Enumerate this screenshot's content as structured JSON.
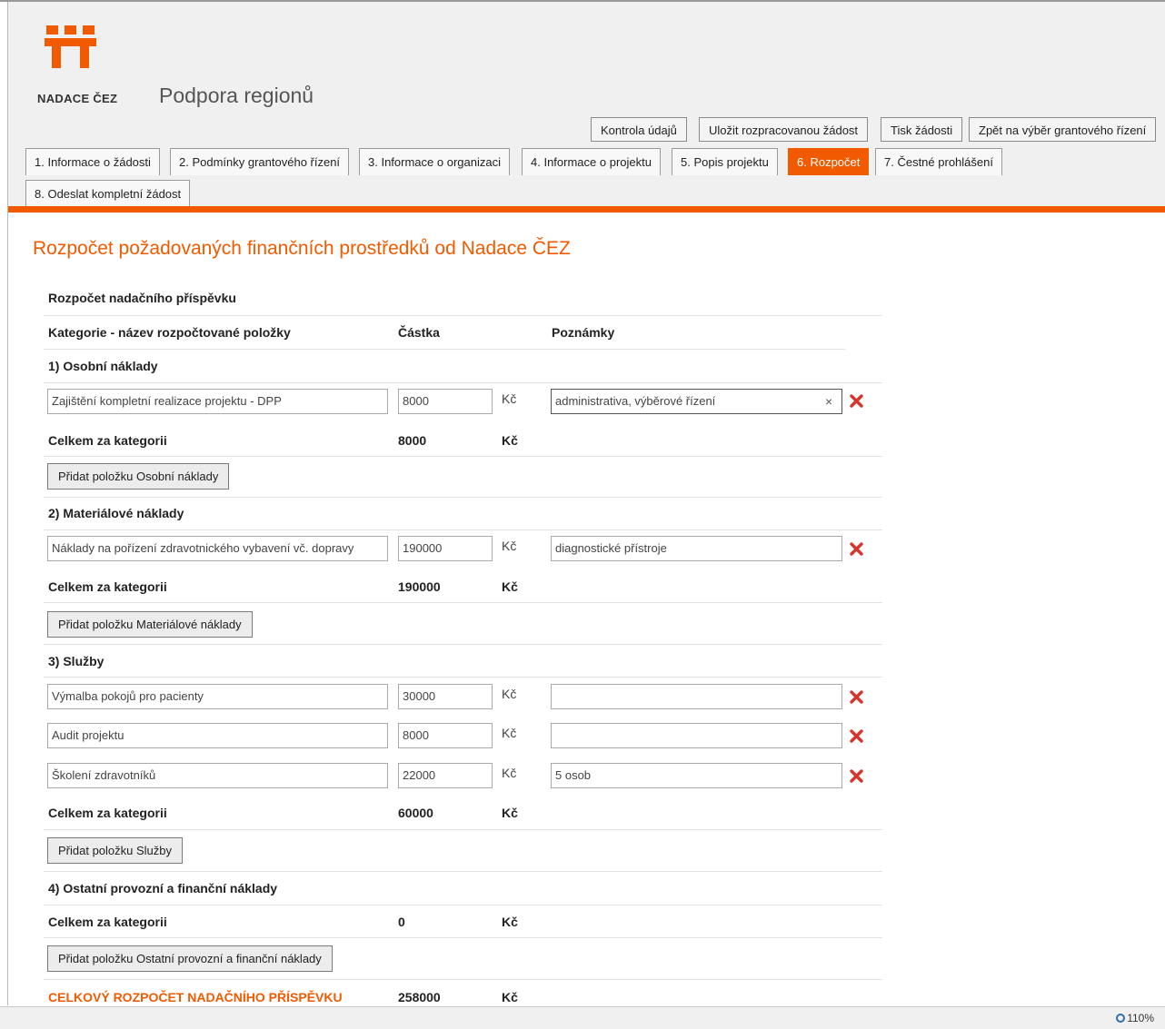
{
  "brand": {
    "name": "NADACE ČEZ",
    "accent": "#f25a00",
    "logo_icon": "nadace-cez-logo"
  },
  "app_title": "Podpora regionů",
  "toolbar": {
    "check": "Kontrola údajů",
    "save": "Uložit rozpracovanou žádost",
    "print": "Tisk žádosti",
    "back": "Zpět na výběr grantového řízení"
  },
  "tabs": [
    {
      "label": "1. Informace o žádosti"
    },
    {
      "label": "2. Podmínky grantového řízení"
    },
    {
      "label": "3. Informace o organizaci"
    },
    {
      "label": "4. Informace o projektu"
    },
    {
      "label": "5. Popis projektu"
    },
    {
      "label": "6. Rozpočet",
      "active": true
    },
    {
      "label": "7. Čestné prohlášení"
    },
    {
      "label": "8. Odeslat kompletní žádost"
    }
  ],
  "page_title": "Rozpočet požadovaných finančních prostředků od Nadace ČEZ",
  "section_title": "Rozpočet nadačního příspěvku",
  "columns": {
    "name": "Kategorie - název rozpočtované položky",
    "amount": "Částka",
    "notes": "Poznámky"
  },
  "currency": "Kč",
  "total_label": "Celkem za kategorii",
  "categories": [
    {
      "title": "1) Osobní náklady",
      "items": [
        {
          "name": "Zajištění kompletní realizace projektu - DPP",
          "amount": "8000",
          "note": "administrativa, výběrové řízení"
        }
      ],
      "total": "8000",
      "add_label": "Přidat položku Osobní náklady"
    },
    {
      "title": "2) Materiálové náklady",
      "items": [
        {
          "name": "Náklady na pořízení zdravotnického vybavení vč. dopravy",
          "amount": "190000",
          "note": "diagnostické přístroje"
        }
      ],
      "total": "190000",
      "add_label": "Přidat položku Materiálové náklady"
    },
    {
      "title": "3) Služby",
      "items": [
        {
          "name": "Výmalba pokojů pro pacienty",
          "amount": "30000",
          "note": ""
        },
        {
          "name": "Audit projektu",
          "amount": "8000",
          "note": ""
        },
        {
          "name": "Školení zdravotníků",
          "amount": "22000",
          "note": "5 osob"
        }
      ],
      "total": "60000",
      "add_label": "Přidat položku Služby"
    },
    {
      "title": "4) Ostatní provozní a finanční náklady",
      "items": [],
      "total": "0",
      "add_label": "Přidat položku Ostatní provozní a finanční náklady"
    }
  ],
  "grand_total": {
    "label": "CELKOVÝ ROZPOČET NADAČNÍHO PŘÍSPĚVKU",
    "amount": "258000"
  },
  "icons": {
    "delete": "delete-icon",
    "clear": "clear-icon",
    "zoom": "zoom-icon"
  },
  "statusbar": {
    "zoom": "110%"
  }
}
